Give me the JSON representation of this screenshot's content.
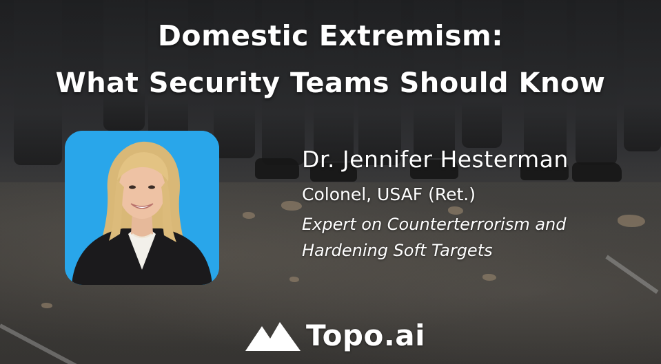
{
  "title": {
    "line1": "Domestic Extremism:",
    "line2": "What Security Teams Should Know"
  },
  "speaker": {
    "photo": "speaker-headshot",
    "name": "Dr. Jennifer Hesterman",
    "rank": "Colonel, USAF (Ret.)",
    "expertise_line1": "Expert on Counterterrorism and",
    "expertise_line2": "Hardening Soft Targets"
  },
  "brand": {
    "icon": "topo-mountain-icon",
    "name": "Topo.ai"
  },
  "colors": {
    "photo_background": "#29a6ea",
    "text": "#ffffff"
  }
}
